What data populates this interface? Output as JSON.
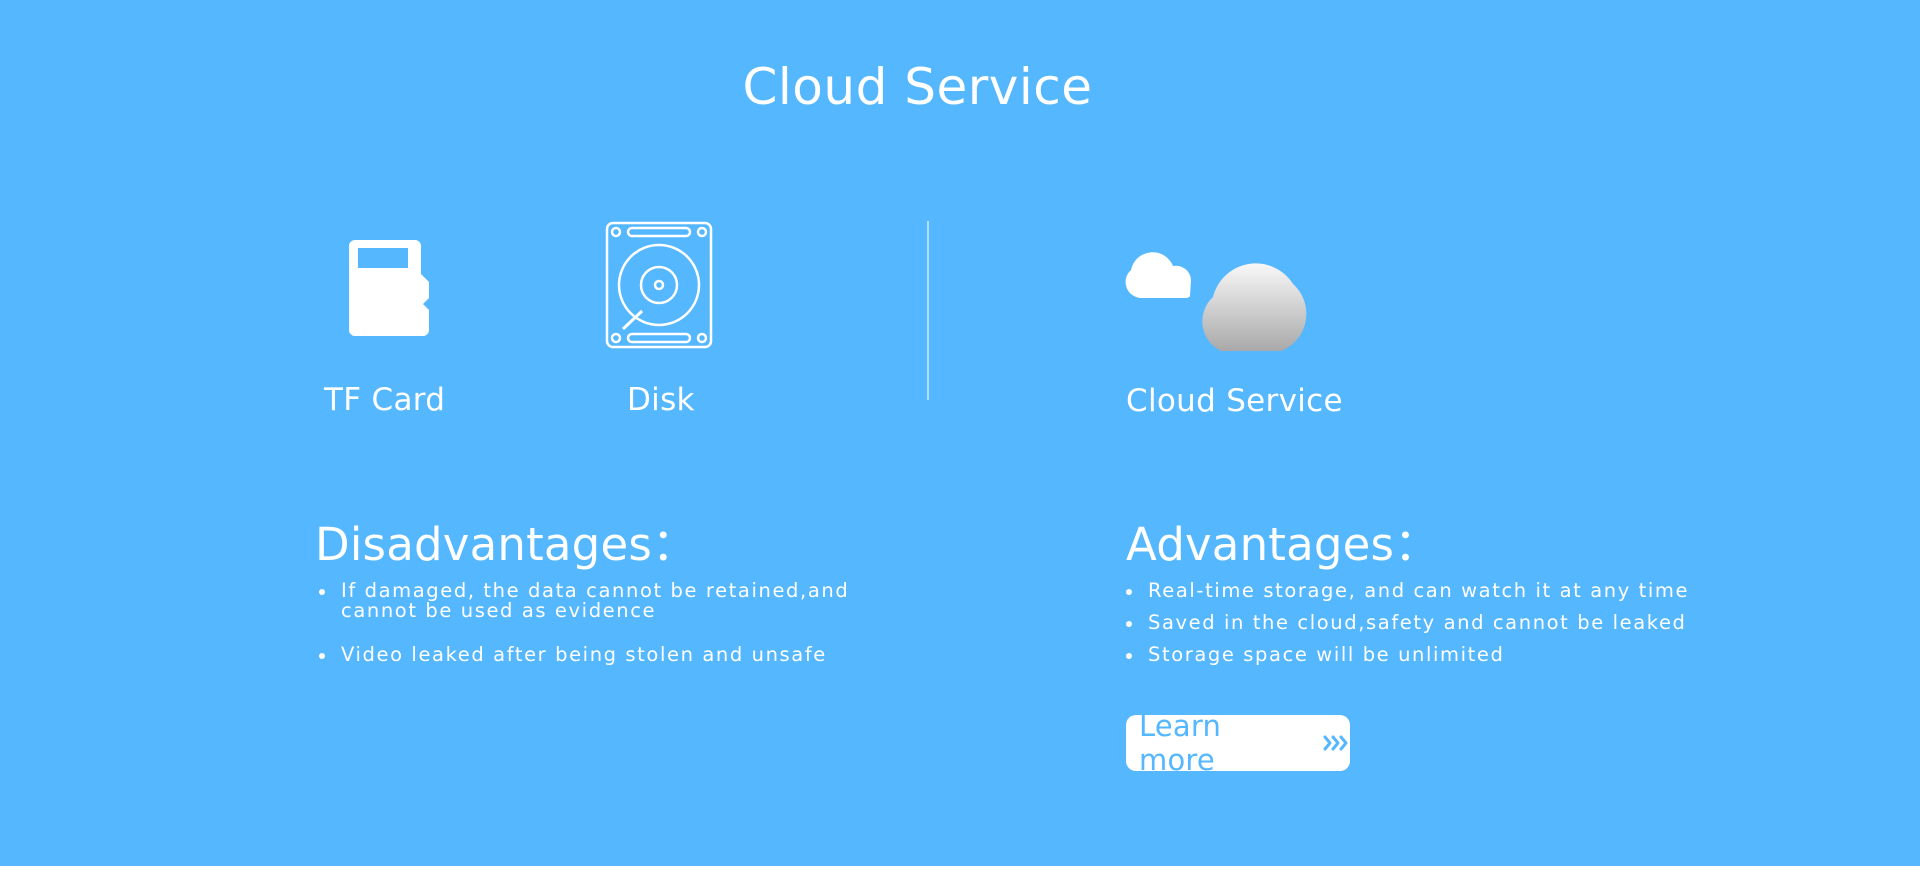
{
  "header": {
    "title": "Cloud Service"
  },
  "storage": {
    "tf_card": {
      "label": "TF Card",
      "icon": "tf-card-icon"
    },
    "disk": {
      "label": "Disk",
      "icon": "hard-disk-icon"
    },
    "cloud": {
      "label": "Cloud Service",
      "icon": "cloud-icon"
    }
  },
  "disadvantages": {
    "heading": "Disadvantages：",
    "items": [
      "If damaged, the data cannot be retained,and cannot be used as evidence",
      "Video leaked after being stolen and unsafe"
    ]
  },
  "advantages": {
    "heading": "Advantages：",
    "items": [
      "Real-time storage, and can watch it at any time",
      "Saved in the cloud,safety and cannot be leaked",
      "Storage space will be unlimited"
    ]
  },
  "cta": {
    "label": "Learn more",
    "icon": "triple-chevron-right-icon"
  },
  "colors": {
    "background": "#55b7fe",
    "text": "#ffffff",
    "button_text": "#55b7fe"
  }
}
